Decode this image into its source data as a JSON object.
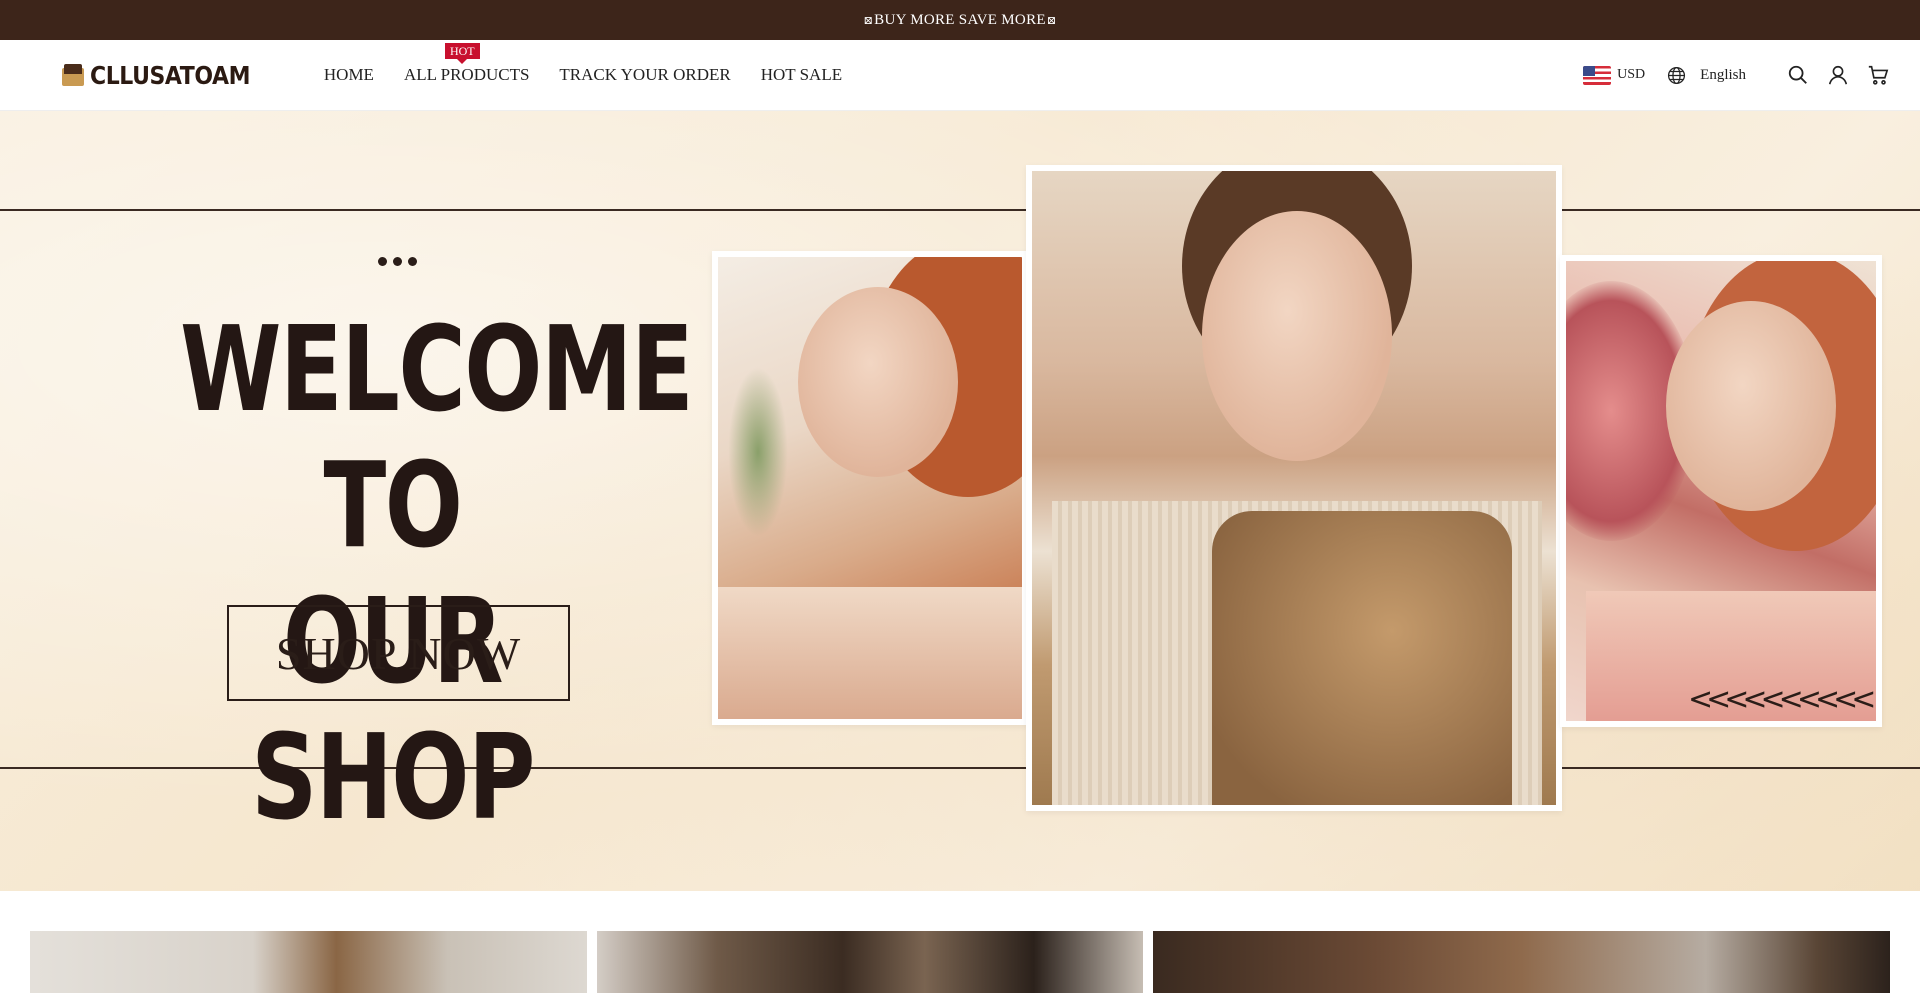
{
  "announcement": {
    "text": "BUY MORE SAVE MORE",
    "left_icon": "x-box-icon",
    "right_icon": "x-box-icon"
  },
  "header": {
    "logo_text": "CLLUSATOAM",
    "nav": [
      {
        "label": "HOME"
      },
      {
        "label": "ALL PRODUCTS",
        "badge": "HOT"
      },
      {
        "label": "TRACK YOUR ORDER"
      },
      {
        "label": "HOT SALE"
      }
    ],
    "currency": "USD",
    "language": "English",
    "icons": [
      "globe-icon",
      "search-icon",
      "account-icon",
      "cart-icon"
    ]
  },
  "hero": {
    "headline_line1": "WELCOME TO",
    "headline_line2": "OUR SHOP",
    "cta_label": "SHOP NOW",
    "chevrons": "<<<<<<<<<<"
  },
  "colors": {
    "announcement_bg": "#3d251a",
    "hot_badge": "#c8102e",
    "hero_bg": "#f8eedc",
    "text_dark": "#241714"
  }
}
